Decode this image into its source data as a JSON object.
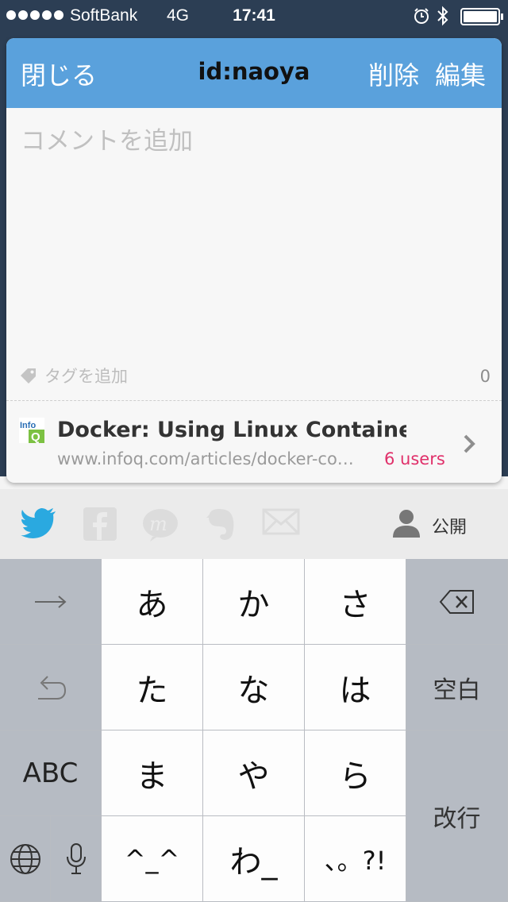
{
  "status_bar": {
    "carrier": "SoftBank",
    "network": "4G",
    "time": "17:41"
  },
  "nav": {
    "close_label": "閉じる",
    "title": "id:naoya",
    "delete_label": "削除",
    "edit_label": "編集"
  },
  "comment": {
    "placeholder": "コメントを追加",
    "value": ""
  },
  "tags": {
    "placeholder": "タグを追加",
    "char_count": "0"
  },
  "entry": {
    "title": "Docker: Using Linux Containers t…",
    "url": "www.infoq.com/articles/docker-co…",
    "users": "6 users",
    "favicon": "infoq-icon"
  },
  "share": {
    "icons": [
      "twitter-icon",
      "facebook-icon",
      "mixi-icon",
      "evernote-icon",
      "mail-icon"
    ],
    "twitter_color": "#2aa9e0",
    "privacy_label": "公開"
  },
  "keyboard": {
    "rows": [
      [
        "→",
        "あ",
        "か",
        "さ",
        "⌫"
      ],
      [
        "↺",
        "た",
        "な",
        "は",
        "空白"
      ],
      [
        "ABC",
        "ま",
        "や",
        "ら",
        "改行"
      ],
      [
        "globe",
        "mic",
        "^_^",
        "わ_",
        "、。?!"
      ]
    ],
    "labels": {
      "r0c1": "あ",
      "r0c2": "か",
      "r0c3": "さ",
      "r1c1": "た",
      "r1c2": "な",
      "r1c3": "は",
      "r1c4": "空白",
      "r2c0": "ABC",
      "r2c1": "ま",
      "r2c2": "や",
      "r2c3": "ら",
      "r2c4": "改行",
      "r3c2": "^_^",
      "r3c3": "わ_",
      "r3c4": "、。?!"
    }
  },
  "colors": {
    "nav_bg": "#5aa1dc",
    "accent_users": "#e0306a",
    "statusbar_bg": "#2c3e54"
  }
}
